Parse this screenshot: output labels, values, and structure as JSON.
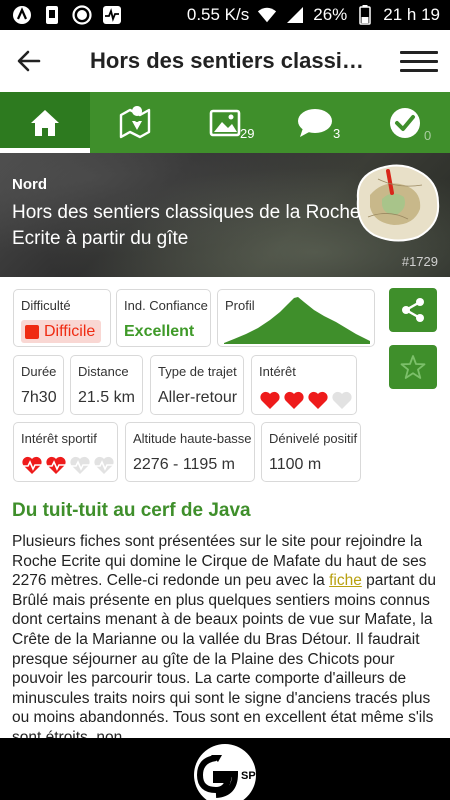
{
  "statusbar": {
    "speed": "0.55 K/s",
    "battery": "26%",
    "time": "21 h 19"
  },
  "appbar": {
    "title": "Hors des sentiers classiques de la Roche Ecrite à partir du gîte"
  },
  "tabs": [
    {
      "name": "home",
      "icon": "home-icon",
      "badge": ""
    },
    {
      "name": "map",
      "icon": "map-pin-icon",
      "badge": ""
    },
    {
      "name": "photos",
      "icon": "image-icon",
      "badge": "29"
    },
    {
      "name": "comments",
      "icon": "comment-icon",
      "badge": "3"
    },
    {
      "name": "done",
      "icon": "check-circle-icon",
      "badge": "0"
    }
  ],
  "hero": {
    "region": "Nord",
    "title": "Hors des sentiers classiques de la Roche Ecrite à partir du gîte",
    "id": "#1729"
  },
  "info": {
    "difficulty": {
      "label": "Difficulté",
      "value": "Difficile",
      "color": "#ef2b12"
    },
    "confidence": {
      "label": "Ind. Confiance",
      "value": "Excellent",
      "color": "#3f9a29"
    },
    "profile": {
      "label": "Profil"
    },
    "duration": {
      "label": "Durée",
      "value": "7h30"
    },
    "distance": {
      "label": "Distance",
      "value": "21.5 km"
    },
    "trip_type": {
      "label": "Type de trajet",
      "value": "Aller-retour"
    },
    "interest": {
      "label": "Intérêt",
      "rating": 3,
      "max": 4
    },
    "sport_interest": {
      "label": "Intérêt sportif",
      "rating": 2,
      "max": 4
    },
    "altitude": {
      "label": "Altitude haute-basse",
      "value": "2276 - 1195 m"
    },
    "elevation": {
      "label": "Dénivelé positif",
      "value": "1100 m"
    }
  },
  "article": {
    "title": "Du tuit-tuit au cerf de Java",
    "text_before_link": "Plusieurs fiches sont présentées sur le site pour rejoindre la Roche Ecrite qui domine le Cirque de Mafate du haut de ses 2276 mètres. Celle-ci redonde un peu avec la ",
    "link_text": "fiche",
    "text_after_link": " partant du Brûlé mais présente en plus quelques sentiers moins connus dont certains menant à de beaux points de vue sur Mafate, la Crête de la Marianne ou la vallée du Bras Détour. Il faudrait presque séjourner au gîte de la Plaine des Chicots pour pouvoir les parcourir tous. La carte comporte d'ailleurs de minuscules traits noirs qui sont le signe d'anciens tracés plus ou moins abandonnés. Tous sont en excellent état même s'ils sont étroits, non"
  },
  "footer": {
    "logo_text": "SPORT"
  },
  "colors": {
    "brand_green": "#3f8f2b",
    "active_tab": "#2d7a1f",
    "difficulty_red": "#ef2b12",
    "link": "#b8a010"
  }
}
